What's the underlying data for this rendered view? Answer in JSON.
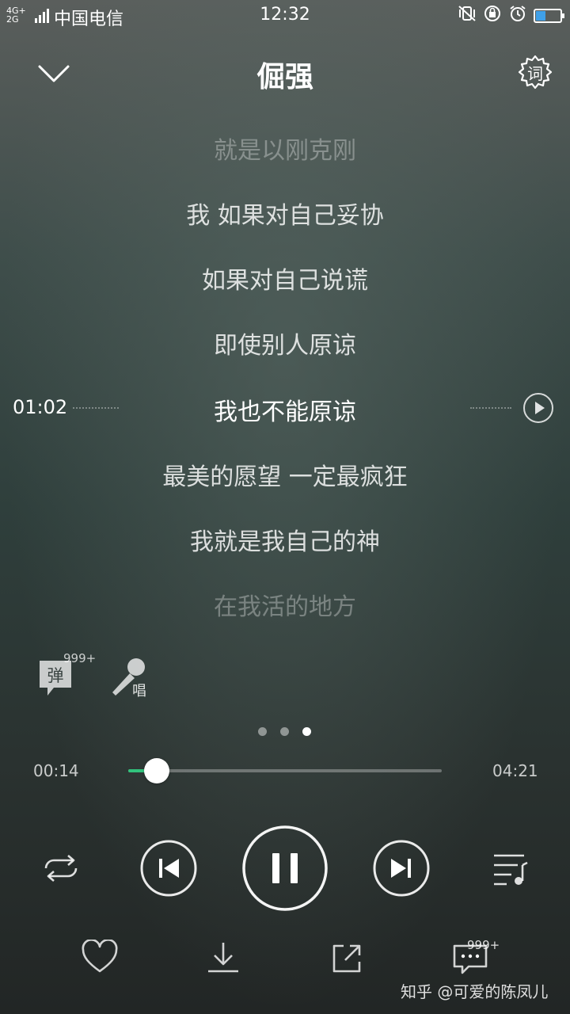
{
  "status_bar": {
    "network_top": "4G+",
    "network_bottom": "2G",
    "carrier": "中国电信",
    "time": "12:32"
  },
  "header": {
    "title": "倔强",
    "lyric_settings_label": "词"
  },
  "lyrics": {
    "lines": [
      "就是以刚克刚",
      "我 如果对自己妥协",
      "如果对自己说谎",
      "即使别人原谅",
      "我也不能原谅",
      "最美的愿望 一定最疯狂",
      "我就是我自己的神",
      "在我活的地方"
    ],
    "current_index": 4,
    "current_line_time": "01:02"
  },
  "extras": {
    "danmu_label": "弹",
    "danmu_count": "999+",
    "sing_label": "唱"
  },
  "pager": {
    "count": 3,
    "active": 2
  },
  "progress": {
    "elapsed": "00:14",
    "duration": "04:21",
    "fraction": 0.09
  },
  "bottom": {
    "comment_count": "999+"
  },
  "watermark": "知乎 @可爱的陈凤儿",
  "colors": {
    "accent": "#31c27c",
    "battery": "#3fa0e8"
  }
}
